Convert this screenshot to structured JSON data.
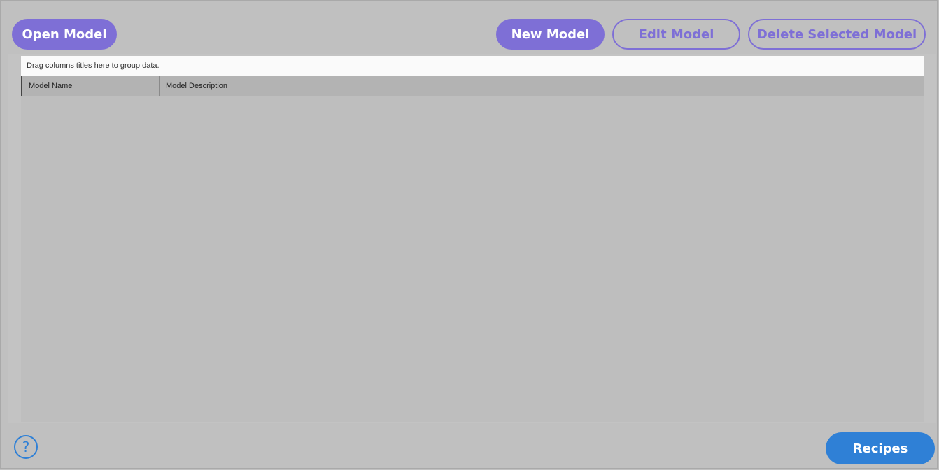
{
  "toolbar": {
    "open_model": "Open Model",
    "new_model": "New Model",
    "edit_model": "Edit Model",
    "delete_selected_model": "Delete Selected Model"
  },
  "grid": {
    "group_panel_hint": "Drag columns titles here to group data.",
    "columns": [
      "Model Name",
      "Model Description"
    ],
    "rows": []
  },
  "footer": {
    "help_glyph": "?",
    "help_icon": "help-circle-icon",
    "recipes": "Recipes"
  },
  "colors": {
    "accent_purple": "#7e6fd6",
    "accent_blue": "#2f80d6",
    "background": "#c0c0c0"
  }
}
